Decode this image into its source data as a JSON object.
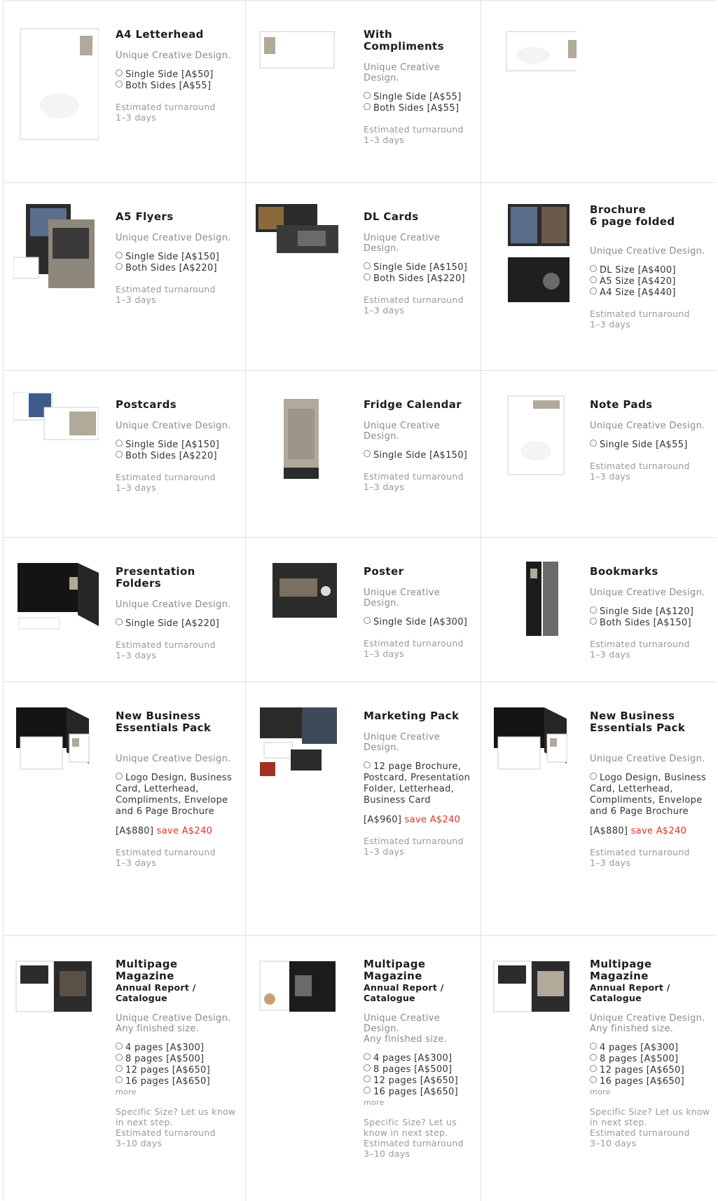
{
  "rows": [
    {
      "cells": [
        {
          "title": "A4 Letterhead",
          "desc": "Unique Creative Design.",
          "opts": [
            "Single Side [A$50]",
            "Both Sides [A$55]"
          ],
          "turn1": "Estimated turnaround",
          "turn2": "1–3 days"
        },
        {
          "title": "With Compliments",
          "desc": "Unique Creative Design.",
          "opts": [
            "Single Side [A$55]",
            "Both Sides [A$55]"
          ],
          "turn1": "Estimated turnaround",
          "turn2": "1–3 days"
        },
        {}
      ]
    },
    {
      "cells": [
        {
          "title": "A5 Flyers",
          "desc": "Unique Creative Design.",
          "opts": [
            "Single Side [A$150]",
            "Both Sides [A$220]"
          ],
          "turn1": "Estimated turnaround",
          "turn2": "1–3 days"
        },
        {
          "title": "DL Cards",
          "desc": "Unique Creative Design.",
          "opts": [
            "Single Side [A$150]",
            "Both Sides [A$220]"
          ],
          "turn1": "Estimated turnaround",
          "turn2": "1–3 days"
        },
        {
          "title": "Brochure",
          "title2": "6 page folded",
          "desc": "Unique Creative Design.",
          "opts": [
            "DL Size [A$400]",
            "A5 Size [A$420]",
            "A4 Size [A$440]"
          ],
          "turn1": "Estimated turnaround",
          "turn2": "1–3 days"
        }
      ]
    },
    {
      "cells": [
        {
          "title": "Postcards",
          "desc": "Unique Creative Design.",
          "opts": [
            "Single Side [A$150]",
            "Both Sides [A$220]"
          ],
          "turn1": "Estimated turnaround",
          "turn2": "1–3 days"
        },
        {
          "title": "Fridge Calendar",
          "desc": "Unique Creative Design.",
          "opts": [
            "Single Side [A$150]"
          ],
          "turn1": "Estimated turnaround",
          "turn2": "1–3 days"
        },
        {
          "title": "Note Pads",
          "desc": "Unique Creative Design.",
          "opts": [
            "Single Side [A$55]"
          ],
          "turn1": "Estimated turnaround",
          "turn2": "1–3 days"
        }
      ]
    },
    {
      "cells": [
        {
          "title": "Presentation Folders",
          "desc": "Unique Creative Design.",
          "opts": [
            "Single Side [A$220]"
          ],
          "turn1": "Estimated turnaround",
          "turn2": "1–3 days"
        },
        {
          "title": "Poster",
          "desc": "Unique Creative Design.",
          "opts": [
            "Single Side [A$300]"
          ],
          "turn1": "Estimated turnaround",
          "turn2": "1–3 days"
        },
        {
          "title": "Bookmarks",
          "desc": "Unique Creative Design.",
          "opts": [
            "Single Side [A$120]",
            "Both Sides [A$150]"
          ],
          "turn1": "Estimated turnaround",
          "turn2": "1–3 days"
        }
      ]
    },
    {
      "cells": [
        {
          "title": "New Business Essentials Pack",
          "desc": "Unique Creative Design.",
          "opts": [
            "Logo Design, Business Card, Letterhead, Compliments, Envelope and 6 Page Brochure"
          ],
          "price": "[A$880]",
          "save": "save A$240",
          "turn1": "Estimated turnaround",
          "turn2": "1–3 days"
        },
        {
          "title": "Marketing Pack",
          "desc": "Unique Creative Design.",
          "opts": [
            "12 page Brochure, Postcard, Presentation Folder, Letterhead, Business Card"
          ],
          "price": "[A$960]",
          "save": "save A$240",
          "turn1": "Estimated turnaround",
          "turn2": "1–3 days"
        },
        {
          "title": "New Business Essentials Pack",
          "desc": "Unique Creative Design.",
          "opts": [
            "Logo Design, Business Card, Letterhead, Compliments, Envelope and 6 Page Brochure"
          ],
          "price": "[A$880]",
          "save": "save A$240",
          "turn1": "Estimated turnaround",
          "turn2": "1–3 days"
        }
      ]
    },
    {
      "cells": [
        {
          "title": "Multipage Magazine",
          "title2": "Annual Report / Catalogue",
          "desc": "Unique Creative Design.",
          "desc2": "Any finished size.",
          "opts": [
            "4 pages [A$300]",
            "8 pages [A$500]",
            "12 pages [A$650]",
            "16 pages [A$650]"
          ],
          "more": "more",
          "specific": "Specific Size? Let us know in next step.",
          "turn1": "Estimated turnaround",
          "turn2": "3–10 days"
        },
        {
          "title": "Multipage Magazine",
          "title2": "Annual Report / Catalogue",
          "desc": "Unique Creative Design.",
          "desc2": "Any finished size.",
          "opts": [
            "4 pages [A$300]",
            "8 pages [A$500]",
            "12 pages [A$650]",
            "16 pages [A$650]"
          ],
          "more": "more",
          "specific": "Specific Size? Let us know in next step.",
          "turn1": "Estimated turnaround",
          "turn2": "3–10 days"
        },
        {
          "title": "Multipage Magazine",
          "title2": "Annual Report / Catalogue",
          "desc": "Unique Creative Design.",
          "desc2": "Any finished size.",
          "opts": [
            "4 pages [A$300]",
            "8 pages [A$500]",
            "12 pages [A$650]",
            "16 pages [A$650]"
          ],
          "more": "more",
          "specific": "Specific Size? Let us know in next step.",
          "turn1": "Estimated turnaround",
          "turn2": "3–10 days"
        }
      ]
    }
  ],
  "colors": {
    "border": "#e2e2e2",
    "save": "#e43020",
    "dark": "#2b2b2b",
    "tan": "#b1a999"
  }
}
